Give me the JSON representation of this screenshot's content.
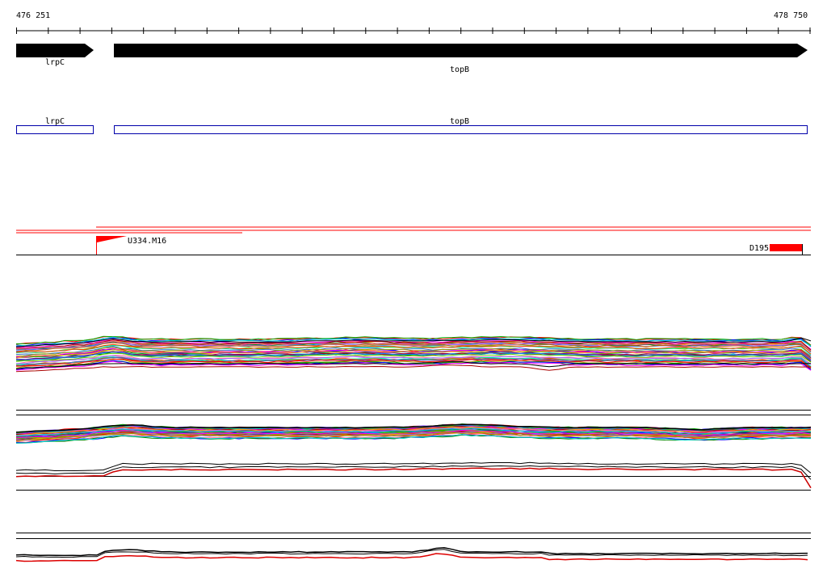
{
  "ruler": {
    "start": "476 251",
    "end": "478 750"
  },
  "genes": [
    {
      "name": "lrpC"
    },
    {
      "name": "topB"
    }
  ],
  "features": [
    {
      "name": "U334.M16"
    },
    {
      "name": "D195"
    }
  ],
  "colors": {
    "arrow": "#000000",
    "box": "#0000aa",
    "feature": "#ff0000",
    "track_line": "#000000"
  }
}
